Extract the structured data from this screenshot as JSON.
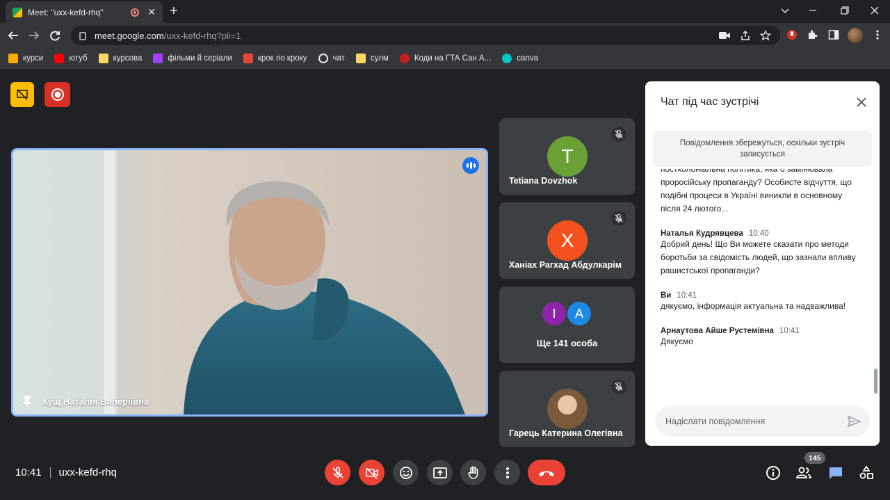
{
  "browser": {
    "tab_title": "Meet: \"uxx-kefd-rhq\"",
    "url_domain": "meet.google.com",
    "url_path": "/uxx-kefd-rhq?pli=1",
    "bookmarks": [
      {
        "label": "курси",
        "icon": "image-icon",
        "color": "#f9ab00"
      },
      {
        "label": "ютуб",
        "icon": "youtube-icon",
        "color": "#ff0000"
      },
      {
        "label": "курсова",
        "icon": "folder-icon",
        "color": "#fdd663"
      },
      {
        "label": "фільми й серіали",
        "icon": "play-icon",
        "color": "#a142f4"
      },
      {
        "label": "крок по кроку",
        "icon": "grid-icon",
        "color": "#e8453c"
      },
      {
        "label": "чат",
        "icon": "openai-icon",
        "color": "#e8eaed"
      },
      {
        "label": "сулм",
        "icon": "folder-icon",
        "color": "#fdd663"
      },
      {
        "label": "Коди на ГТА Сан А...",
        "icon": "gta-icon",
        "color": "#c5221f"
      },
      {
        "label": "canva",
        "icon": "canva-icon",
        "color": "#00c4cc"
      }
    ]
  },
  "meeting": {
    "time": "10:41",
    "code": "uxx-kefd-rhq",
    "main_speaker": "Кущ Наталія Валеріївна",
    "participant_count": "145"
  },
  "tiles": [
    {
      "name": "Tetiana Dovzhok",
      "initial": "T",
      "color": "#6aa035"
    },
    {
      "name": "Ханіах Рагхад Абдулкарім",
      "initial": "X",
      "color": "#f4511e"
    },
    {
      "more_label": "Ще 141 особа",
      "avatars": [
        {
          "initial": "I",
          "color": "#8e24aa"
        },
        {
          "initial": "A",
          "color": "#1e88e5"
        }
      ]
    },
    {
      "name": "Гарець Катерина Олегівна",
      "initial": "",
      "color": "#7a5a3a"
    }
  ],
  "chat": {
    "title": "Чат під час зустрічі",
    "notice": "Повідомлення збережуться, оскільки зустріч записується",
    "first_fragment": "постколоніальна політика, яка б замінювала проросійську пропаганду? Особисте відчуття, що подібні процеси в Україні виникли в основному після 24 лютого...",
    "messages": [
      {
        "sender": "Наталья Кудрявцева",
        "time": "10:40",
        "text": "Добрий день! Що Ви можете сказати про методи боротьби за свідомість людей, що зазнали впливу рашистської пропаганди?"
      },
      {
        "sender": "Ви",
        "time": "10:41",
        "text": "дякуємо, інформація актуальна та надважлива!"
      },
      {
        "sender": "Арнаутова Айше Рустемівна",
        "time": "10:41",
        "text": "Дякуємо"
      }
    ],
    "input_placeholder": "Надіслати повідомлення"
  },
  "colors": {
    "accent_blue": "#8ab4f8",
    "danger_red": "#ea4335",
    "record_yellow": "#fbbc04"
  }
}
